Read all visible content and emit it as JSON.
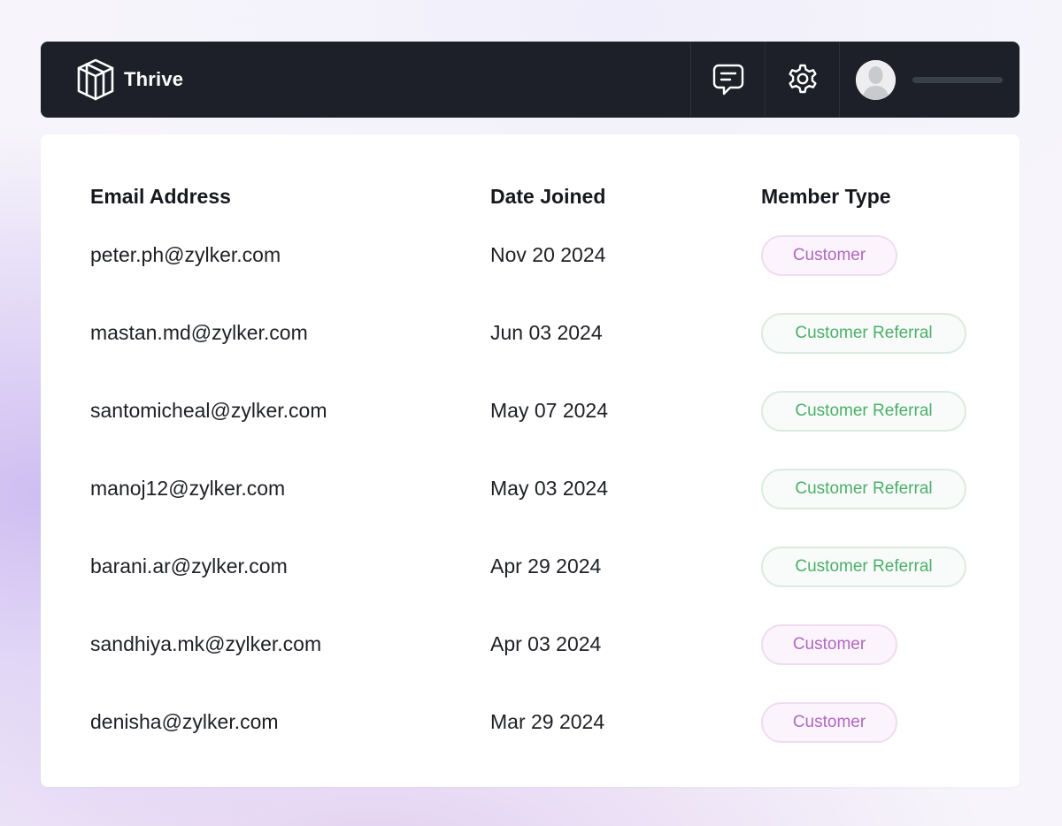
{
  "header": {
    "brand_name": "Thrive",
    "icons": {
      "logo": "cube-logo-icon",
      "chat": "chat-icon",
      "settings": "gear-icon",
      "avatar": "user-avatar-icon"
    }
  },
  "table": {
    "columns": {
      "email": "Email Address",
      "date": "Date Joined",
      "type": "Member Type"
    },
    "rows": [
      {
        "email": "peter.ph@zylker.com",
        "date": "Nov 20 2024",
        "type": "Customer"
      },
      {
        "email": "mastan.md@zylker.com",
        "date": "Jun 03 2024",
        "type": "Customer Referral"
      },
      {
        "email": "santomicheal@zylker.com",
        "date": "May 07 2024",
        "type": "Customer Referral"
      },
      {
        "email": "manoj12@zylker.com",
        "date": "May 03 2024",
        "type": "Customer Referral"
      },
      {
        "email": "barani.ar@zylker.com",
        "date": "Apr 29 2024",
        "type": "Customer Referral"
      },
      {
        "email": "sandhiya.mk@zylker.com",
        "date": "Apr 03 2024",
        "type": "Customer"
      },
      {
        "email": "denisha@zylker.com",
        "date": "Mar 29 2024",
        "type": "Customer"
      }
    ]
  },
  "colors": {
    "topbar_bg": "#1d2028",
    "customer_badge_text": "#b068c0",
    "customer_badge_border": "#f0dcf0",
    "referral_badge_text": "#4caf6a",
    "referral_badge_border": "#dcebe2"
  }
}
